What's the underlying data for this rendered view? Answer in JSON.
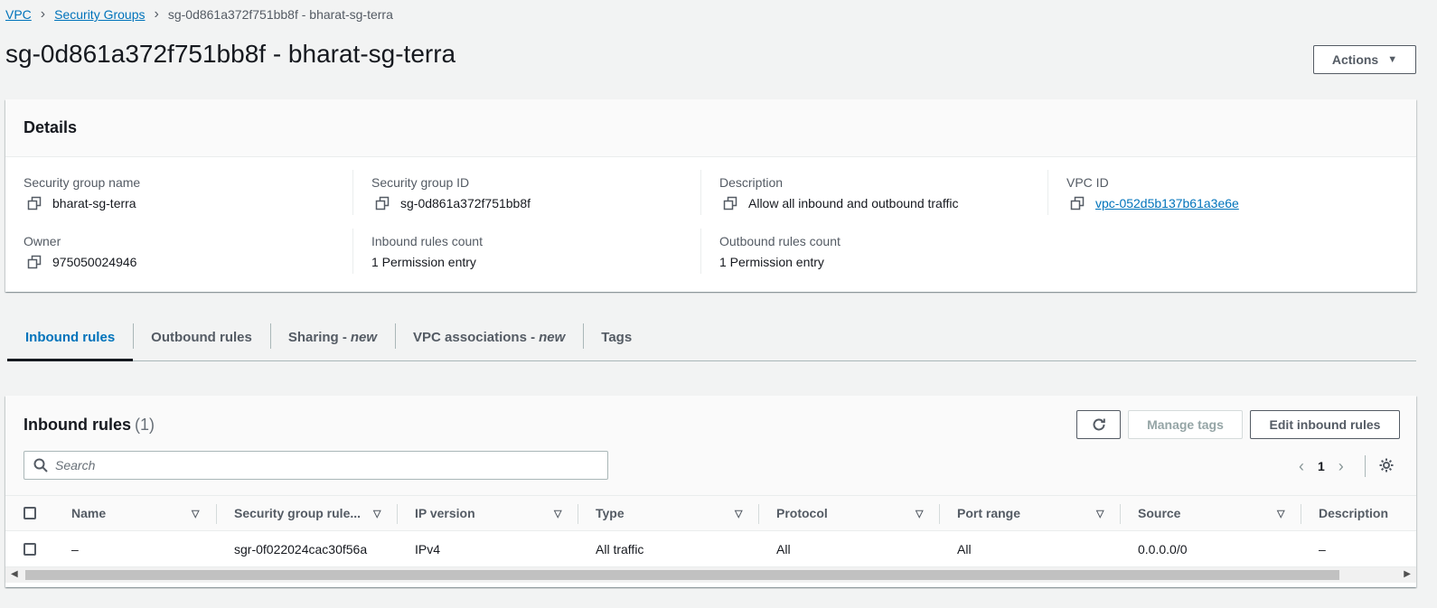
{
  "breadcrumb": {
    "items": [
      "VPC",
      "Security Groups"
    ],
    "current": "sg-0d861a372f751bb8f - bharat-sg-terra"
  },
  "page_title": "sg-0d861a372f751bb8f - bharat-sg-terra",
  "actions_label": "Actions",
  "details": {
    "title": "Details",
    "sg_name_label": "Security group name",
    "sg_name": "bharat-sg-terra",
    "sg_id_label": "Security group ID",
    "sg_id": "sg-0d861a372f751bb8f",
    "description_label": "Description",
    "description": "Allow all inbound and outbound traffic",
    "vpc_id_label": "VPC ID",
    "vpc_id": "vpc-052d5b137b61a3e6e",
    "owner_label": "Owner",
    "owner": "975050024946",
    "inbound_count_label": "Inbound rules count",
    "inbound_count": "1 Permission entry",
    "outbound_count_label": "Outbound rules count",
    "outbound_count": "1 Permission entry"
  },
  "tabs": [
    {
      "label": "Inbound rules",
      "suffix": ""
    },
    {
      "label": "Outbound rules",
      "suffix": ""
    },
    {
      "label": "Sharing -",
      "suffix": "new"
    },
    {
      "label": "VPC associations -",
      "suffix": "new"
    },
    {
      "label": "Tags",
      "suffix": ""
    }
  ],
  "inbound": {
    "title": "Inbound rules",
    "count": "(1)",
    "manage_tags_label": "Manage tags",
    "edit_label": "Edit inbound rules",
    "search_placeholder": "Search",
    "page": "1",
    "columns": [
      "Name",
      "Security group rule...",
      "IP version",
      "Type",
      "Protocol",
      "Port range",
      "Source",
      "Description"
    ],
    "rows": [
      [
        "–",
        "sgr-0f022024cac30f56a",
        "IPv4",
        "All traffic",
        "All",
        "All",
        "0.0.0.0/0",
        "–"
      ]
    ]
  },
  "colors": {
    "link": "#0073bb",
    "background": "#f2f3f3",
    "text": "#16191f",
    "muted": "#545b64"
  }
}
